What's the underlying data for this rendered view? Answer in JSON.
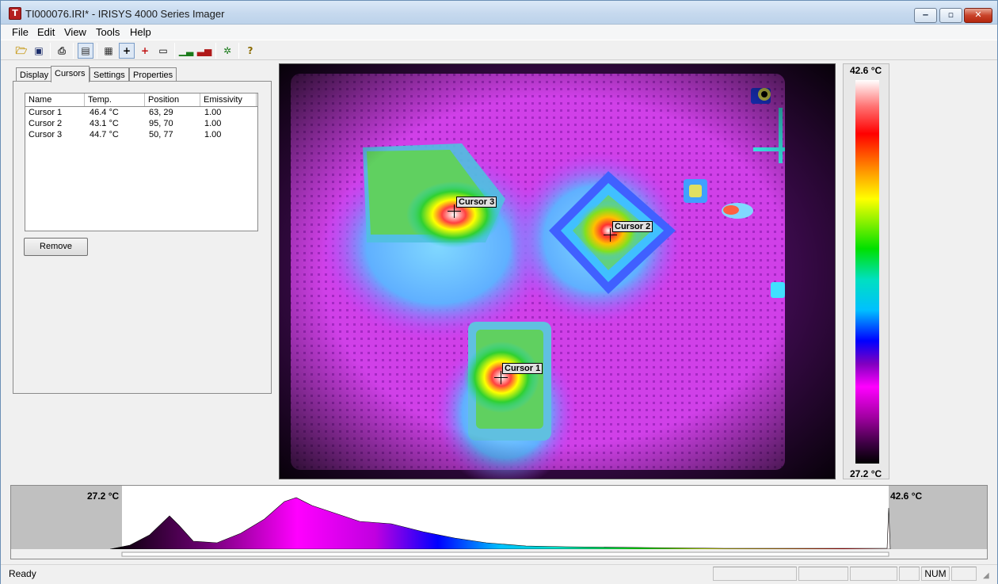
{
  "window": {
    "title": "TI000076.IRI* - IRISYS 4000 Series Imager",
    "minimize": "‒",
    "maximize": "▫",
    "close": "✕"
  },
  "menu": [
    "File",
    "Edit",
    "View",
    "Tools",
    "Help"
  ],
  "tabs": [
    "Display",
    "Cursors",
    "Settings",
    "Properties"
  ],
  "active_tab": "Cursors",
  "cursor_table": {
    "headers": [
      "Name",
      "Temp.",
      "Position",
      "Emissivity"
    ],
    "rows": [
      {
        "name": "Cursor 1",
        "temp": "46.4 °C",
        "position": "63, 29",
        "emissivity": "1.00"
      },
      {
        "name": "Cursor 2",
        "temp": "43.1 °C",
        "position": "95, 70",
        "emissivity": "1.00"
      },
      {
        "name": "Cursor 3",
        "temp": "44.7 °C",
        "position": "50, 77",
        "emissivity": "1.00"
      }
    ]
  },
  "remove_button": "Remove",
  "image_cursors": [
    "Cursor 1",
    "Cursor 2",
    "Cursor 3"
  ],
  "scale": {
    "max": "42.6 °C",
    "min": "27.2 °C"
  },
  "histogram": {
    "min": "27.2 °C",
    "max": "42.6 °C"
  },
  "status": {
    "text": "Ready",
    "num": "NUM"
  }
}
